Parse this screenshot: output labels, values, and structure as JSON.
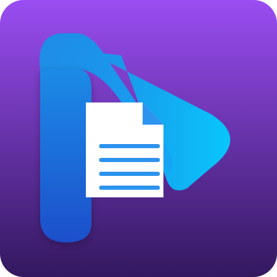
{
  "icon": {
    "name": "document-play-app-icon",
    "colors": {
      "background_top": "#9A4DF2",
      "background_bottom": "#33185F",
      "blue_light": "#08C6FB",
      "blue_mid": "#1F8BE6",
      "blue_dark": "#1D4FCB",
      "document_white": "#FFFFFF",
      "document_lines": "#2C93EE"
    }
  }
}
